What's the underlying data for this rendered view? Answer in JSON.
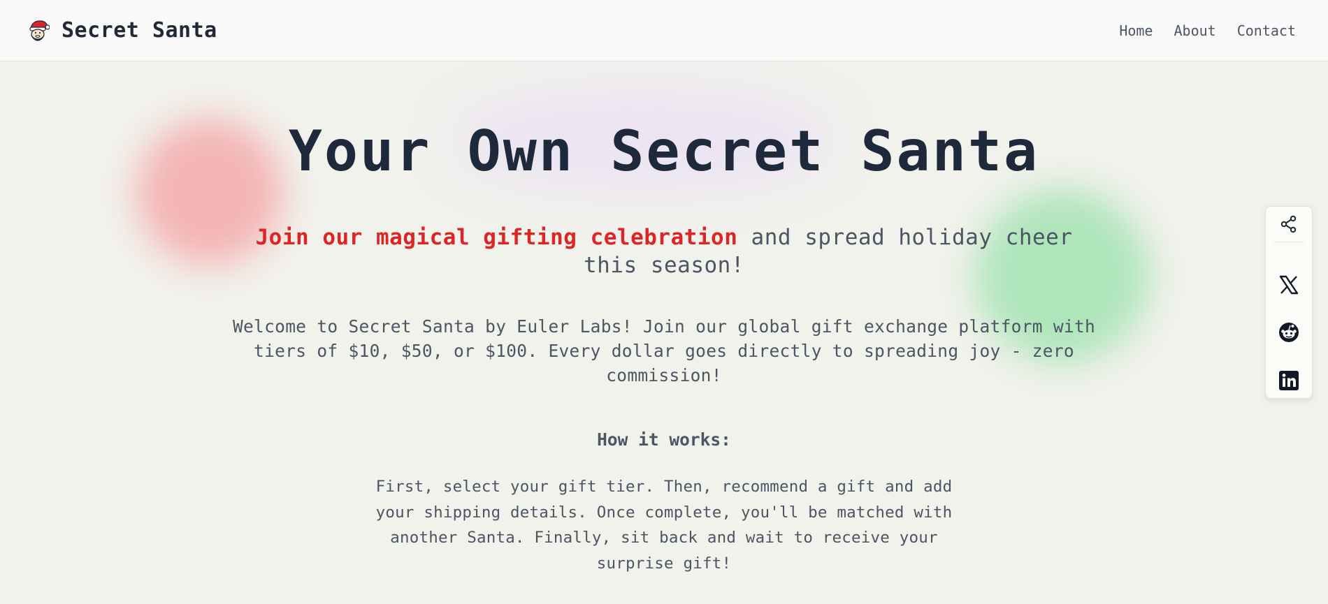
{
  "nav": {
    "brand_title": "Secret Santa",
    "logo_icon": "santa-face-icon",
    "links": [
      "Home",
      "About",
      "Contact"
    ]
  },
  "hero": {
    "title": "Your Own Secret Santa",
    "tagline_highlight": "Join our magical gifting celebration",
    "tagline_rest": " and spread holiday cheer this season!",
    "welcome": "Welcome to Secret Santa by Euler Labs! Join our global gift exchange platform with tiers of $10, $50, or $100. Every dollar goes directly to spreading joy - zero commission!",
    "how_title": "How it works:",
    "how_body": "First, select your gift tier. Then, recommend a gift and add your shipping details. Once complete, you'll be matched with another Santa. Finally, sit back and wait to receive your surprise gift!"
  },
  "share": {
    "icons": [
      "share-icon",
      "x-icon",
      "reddit-icon",
      "linkedin-icon"
    ]
  },
  "colors": {
    "accent_red": "#dc2626",
    "text_dark": "#1e293b",
    "text_muted": "#4b5563",
    "background": "#f2f2ec",
    "blob_red": "#f3b4b4",
    "blob_green": "#afe5bb",
    "blob_purple": "#ebe3f3"
  }
}
